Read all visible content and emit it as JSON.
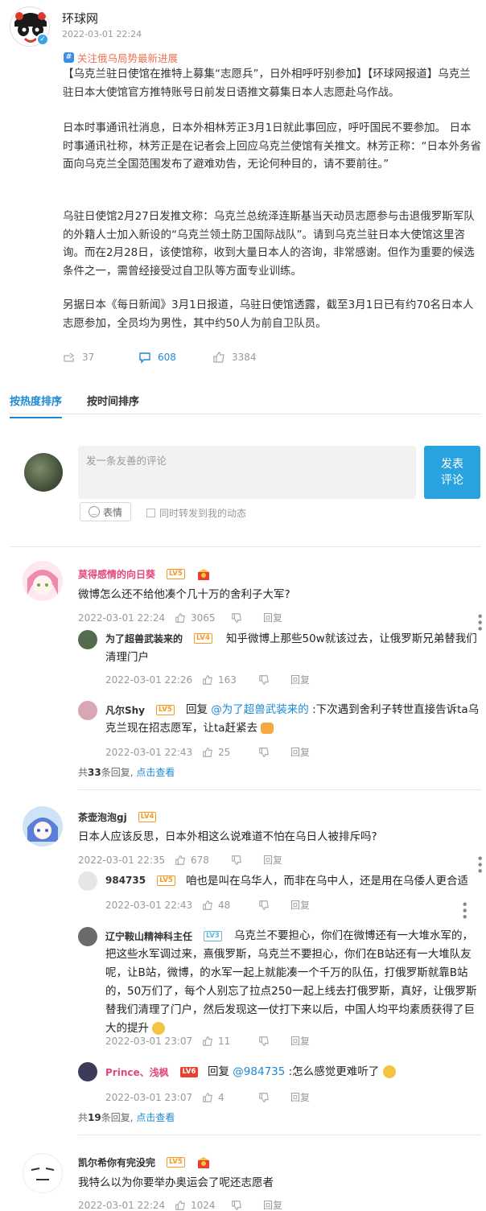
{
  "post": {
    "author": "环球网",
    "time": "2022-03-01 22:24",
    "topic": "关注俄乌局势最新进展",
    "paragraphs": [
      "【乌克兰驻日使馆在推特上募集“志愿兵”，日外相呼吁别参加】【环球网报道】乌克兰驻日本大使馆官方推特账号日前发日语推文募集日本人志愿赴乌作战。",
      "日本时事通讯社消息，日本外相林芳正3月1日就此事回应，呼吁国民不要参加。 日本时事通讯社称，林芳正是在记者会上回应乌克兰使馆有关推文。林芳正称：“日本外务省面向乌克兰全国范围发布了避难劝告，无论何种目的，请不要前往。”",
      "乌驻日使馆2月27日发推文称：乌克兰总统泽连斯基当天动员志愿参与击退俄罗斯军队的外籍人士加入新设的“乌克兰领土防卫国际战队”。请到乌克兰驻日本大使馆这里咨询。而在2月28日，该使馆称，收到大量日本人的咨询，非常感谢。但作为重要的候选条件之一，需曾经接受过自卫队等方面专业训练。",
      "另据日本《每日新闻》3月1日报道，乌驻日使馆透露，截至3月1日已有约70名日本人志愿参加，全员均为男性，其中约50人为前自卫队员。"
    ],
    "reposts": "37",
    "comments": "608",
    "likes": "3384"
  },
  "tabs": {
    "hot": "按热度排序",
    "time": "按时间排序"
  },
  "composer": {
    "placeholder": "发一条友善的评论",
    "submit_line1": "发表",
    "submit_line2": "评论",
    "emoji_label": "表情",
    "repost_label": "同时转发到我的动态"
  },
  "comments": [
    {
      "user": "莫得感情的向日葵",
      "level": "LV5",
      "text": "微博怎么还不给他凑个几十万的舍利子大军?",
      "time": "2022-03-01 22:24",
      "likes": "3065",
      "reply_label": "回复",
      "replies": [
        {
          "user": "为了超兽武装来的",
          "level": "LV4",
          "text": "知乎微博上那些50w就该过去，让俄罗斯兄弟替我们清理门户",
          "time": "2022-03-01 22:26",
          "likes": "163",
          "reply_label": "回复"
        },
        {
          "user": "凡尔Shy",
          "level": "LV5",
          "prefix": "回复",
          "mention": "@为了超兽武装来的",
          "text": ":下次遇到舍利子转世直接告诉ta乌克兰现在招志愿军，让ta赶紧去",
          "time": "2022-03-01 22:43",
          "likes": "25",
          "reply_label": "回复"
        }
      ],
      "more_prefix": "共",
      "more_count": "33",
      "more_suffix": "条回复,",
      "more_link": "点击查看"
    },
    {
      "user": "茶壶泡泡gj",
      "level": "LV4",
      "text": "日本人应该反思，日本外相这么说难道不怕在乌日人被排斥吗?",
      "time": "2022-03-01 22:35",
      "likes": "678",
      "reply_label": "回复",
      "replies": [
        {
          "user": "984735",
          "level": "LV5",
          "text": "咱也是叫在乌华人，而非在乌中人，还是用在乌倭人更合适",
          "time": "2022-03-01 22:43",
          "likes": "48",
          "reply_label": "回复"
        },
        {
          "user": "辽宁鞍山精神科主任",
          "level": "LV3",
          "text": "乌克兰不要担心，你们在微博还有一大堆水军的，把这些水军调过来，熹俄罗斯，乌克兰不要担心，你们在B站还有一大堆队友呢，让B站，微博，的水军一起上就能凑一个千万的队伍，打俄罗斯就靠B站的，50万们了，每个人别忘了拉点250一起上线去打俄罗斯，真好，让俄罗斯替我们清理了门户，然后发现这一仗打下来以后，中国人均平均素质获得了巨大的提升",
          "time": "2022-03-01 23:07",
          "likes": "11",
          "reply_label": "回复"
        },
        {
          "user": "Prince、浅枫",
          "level": "LV6",
          "prefix": "回复",
          "mention": "@984735",
          "text": ":怎么感觉更难听了",
          "time": "2022-03-01 23:07",
          "likes": "4",
          "reply_label": "回复"
        }
      ],
      "more_prefix": "共",
      "more_count": "19",
      "more_suffix": "条回复,",
      "more_link": "点击查看"
    },
    {
      "user": "凯尔希你有完没完",
      "level": "LV5",
      "text": "我特么以为你要举办奥运会了呢还志愿者",
      "time": "2022-03-01 22:24",
      "likes": "1024",
      "reply_label": "回复"
    }
  ],
  "colors": {
    "accent": "#1e88d4",
    "topic": "#eb7350",
    "pink_name": "#e0497a"
  }
}
